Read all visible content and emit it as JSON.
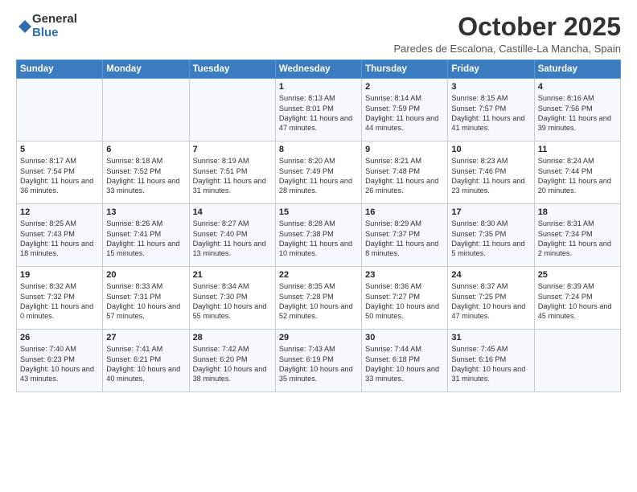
{
  "logo": {
    "general": "General",
    "blue": "Blue"
  },
  "header": {
    "month": "October 2025",
    "subtitle": "Paredes de Escalona, Castille-La Mancha, Spain"
  },
  "weekdays": [
    "Sunday",
    "Monday",
    "Tuesday",
    "Wednesday",
    "Thursday",
    "Friday",
    "Saturday"
  ],
  "weeks": [
    [
      {
        "day": "",
        "info": ""
      },
      {
        "day": "",
        "info": ""
      },
      {
        "day": "",
        "info": ""
      },
      {
        "day": "1",
        "info": "Sunrise: 8:13 AM\nSunset: 8:01 PM\nDaylight: 11 hours and 47 minutes."
      },
      {
        "day": "2",
        "info": "Sunrise: 8:14 AM\nSunset: 7:59 PM\nDaylight: 11 hours and 44 minutes."
      },
      {
        "day": "3",
        "info": "Sunrise: 8:15 AM\nSunset: 7:57 PM\nDaylight: 11 hours and 41 minutes."
      },
      {
        "day": "4",
        "info": "Sunrise: 8:16 AM\nSunset: 7:56 PM\nDaylight: 11 hours and 39 minutes."
      }
    ],
    [
      {
        "day": "5",
        "info": "Sunrise: 8:17 AM\nSunset: 7:54 PM\nDaylight: 11 hours and 36 minutes."
      },
      {
        "day": "6",
        "info": "Sunrise: 8:18 AM\nSunset: 7:52 PM\nDaylight: 11 hours and 33 minutes."
      },
      {
        "day": "7",
        "info": "Sunrise: 8:19 AM\nSunset: 7:51 PM\nDaylight: 11 hours and 31 minutes."
      },
      {
        "day": "8",
        "info": "Sunrise: 8:20 AM\nSunset: 7:49 PM\nDaylight: 11 hours and 28 minutes."
      },
      {
        "day": "9",
        "info": "Sunrise: 8:21 AM\nSunset: 7:48 PM\nDaylight: 11 hours and 26 minutes."
      },
      {
        "day": "10",
        "info": "Sunrise: 8:23 AM\nSunset: 7:46 PM\nDaylight: 11 hours and 23 minutes."
      },
      {
        "day": "11",
        "info": "Sunrise: 8:24 AM\nSunset: 7:44 PM\nDaylight: 11 hours and 20 minutes."
      }
    ],
    [
      {
        "day": "12",
        "info": "Sunrise: 8:25 AM\nSunset: 7:43 PM\nDaylight: 11 hours and 18 minutes."
      },
      {
        "day": "13",
        "info": "Sunrise: 8:26 AM\nSunset: 7:41 PM\nDaylight: 11 hours and 15 minutes."
      },
      {
        "day": "14",
        "info": "Sunrise: 8:27 AM\nSunset: 7:40 PM\nDaylight: 11 hours and 13 minutes."
      },
      {
        "day": "15",
        "info": "Sunrise: 8:28 AM\nSunset: 7:38 PM\nDaylight: 11 hours and 10 minutes."
      },
      {
        "day": "16",
        "info": "Sunrise: 8:29 AM\nSunset: 7:37 PM\nDaylight: 11 hours and 8 minutes."
      },
      {
        "day": "17",
        "info": "Sunrise: 8:30 AM\nSunset: 7:35 PM\nDaylight: 11 hours and 5 minutes."
      },
      {
        "day": "18",
        "info": "Sunrise: 8:31 AM\nSunset: 7:34 PM\nDaylight: 11 hours and 2 minutes."
      }
    ],
    [
      {
        "day": "19",
        "info": "Sunrise: 8:32 AM\nSunset: 7:32 PM\nDaylight: 11 hours and 0 minutes."
      },
      {
        "day": "20",
        "info": "Sunrise: 8:33 AM\nSunset: 7:31 PM\nDaylight: 10 hours and 57 minutes."
      },
      {
        "day": "21",
        "info": "Sunrise: 8:34 AM\nSunset: 7:30 PM\nDaylight: 10 hours and 55 minutes."
      },
      {
        "day": "22",
        "info": "Sunrise: 8:35 AM\nSunset: 7:28 PM\nDaylight: 10 hours and 52 minutes."
      },
      {
        "day": "23",
        "info": "Sunrise: 8:36 AM\nSunset: 7:27 PM\nDaylight: 10 hours and 50 minutes."
      },
      {
        "day": "24",
        "info": "Sunrise: 8:37 AM\nSunset: 7:25 PM\nDaylight: 10 hours and 47 minutes."
      },
      {
        "day": "25",
        "info": "Sunrise: 8:39 AM\nSunset: 7:24 PM\nDaylight: 10 hours and 45 minutes."
      }
    ],
    [
      {
        "day": "26",
        "info": "Sunrise: 7:40 AM\nSunset: 6:23 PM\nDaylight: 10 hours and 43 minutes."
      },
      {
        "day": "27",
        "info": "Sunrise: 7:41 AM\nSunset: 6:21 PM\nDaylight: 10 hours and 40 minutes."
      },
      {
        "day": "28",
        "info": "Sunrise: 7:42 AM\nSunset: 6:20 PM\nDaylight: 10 hours and 38 minutes."
      },
      {
        "day": "29",
        "info": "Sunrise: 7:43 AM\nSunset: 6:19 PM\nDaylight: 10 hours and 35 minutes."
      },
      {
        "day": "30",
        "info": "Sunrise: 7:44 AM\nSunset: 6:18 PM\nDaylight: 10 hours and 33 minutes."
      },
      {
        "day": "31",
        "info": "Sunrise: 7:45 AM\nSunset: 6:16 PM\nDaylight: 10 hours and 31 minutes."
      },
      {
        "day": "",
        "info": ""
      }
    ]
  ]
}
